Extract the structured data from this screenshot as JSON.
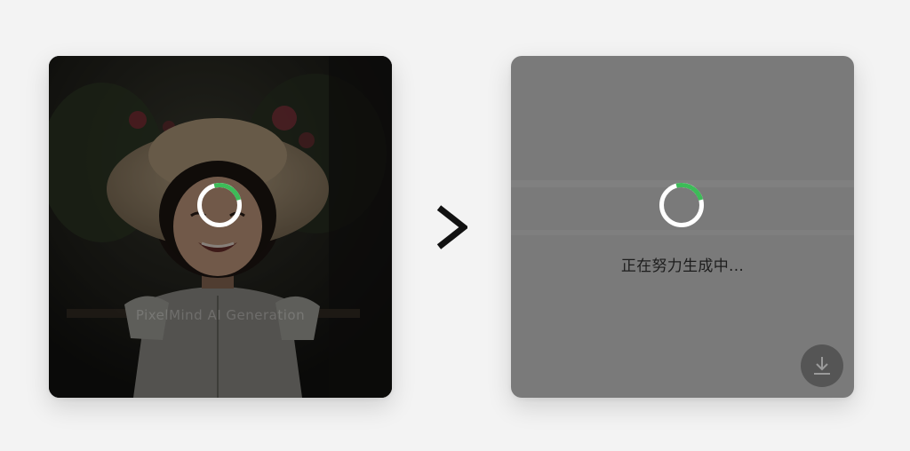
{
  "source_card": {
    "image": "smiling-girl-sun-hat-photo",
    "watermark_text": "PixelMind AI Generation",
    "loading": true,
    "spinner_icon": "loading-spinner-icon"
  },
  "arrow_icon": "chevron-right-icon",
  "result_card": {
    "status_text": "正在努力生成中...",
    "spinner_icon": "loading-spinner-icon",
    "download_icon": "download-icon"
  },
  "colors": {
    "accent": "#3dbb58",
    "page_background": "#f3f3f3",
    "result_overlay": "#7a7a7a",
    "download_button": "#555555"
  }
}
